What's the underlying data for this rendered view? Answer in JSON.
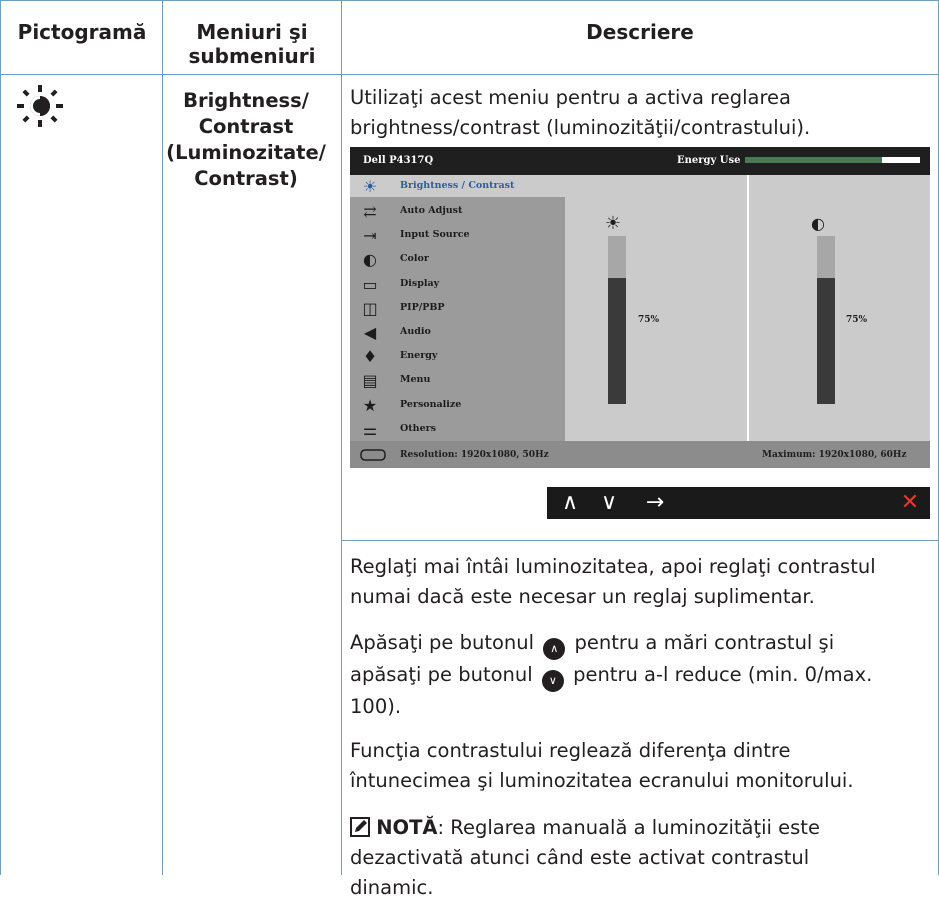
{
  "header": {
    "col1": "Pictogramă",
    "col2_line1": "Meniuri şi",
    "col2_line2": "submeniuri",
    "col3": "Descriere"
  },
  "menu_name": {
    "line1": "Brightness/",
    "line2": "Contrast",
    "line3": "(Luminozitate/",
    "line4": "Contrast)"
  },
  "intro": {
    "line1": "Utilizaţi acest meniu pentru a activa reglarea",
    "line2": "brightness/contrast (luminozităţii/contrastului)."
  },
  "osd": {
    "title": "Dell P4317Q",
    "energy_label": "Energy Use",
    "energy_level": 0.78,
    "items": [
      {
        "icon": "brightness-icon",
        "glyph": "☀",
        "label": "Brightness / Contrast",
        "selected": true
      },
      {
        "icon": "auto-adjust-icon",
        "glyph": "⇄",
        "label": "Auto Adjust"
      },
      {
        "icon": "input-source-icon",
        "glyph": "⇥",
        "label": "Input Source"
      },
      {
        "icon": "color-icon",
        "glyph": "◐",
        "label": "Color"
      },
      {
        "icon": "display-icon",
        "glyph": "▭",
        "label": "Display"
      },
      {
        "icon": "pip-pbp-icon",
        "glyph": "◫",
        "label": "PIP/PBP"
      },
      {
        "icon": "audio-icon",
        "glyph": "◀",
        "label": "Audio"
      },
      {
        "icon": "energy-icon",
        "glyph": "♦",
        "label": "Energy"
      },
      {
        "icon": "menu-icon",
        "glyph": "▤",
        "label": "Menu"
      },
      {
        "icon": "personalize-icon",
        "glyph": "★",
        "label": "Personalize"
      },
      {
        "icon": "others-icon",
        "glyph": "⚌",
        "label": "Others"
      }
    ],
    "brightness": {
      "icon": "☀",
      "value_label": "75%",
      "level": 0.75
    },
    "contrast": {
      "icon": "◐",
      "value_label": "75%",
      "level": 0.75
    },
    "resolution": "Resolution: 1920x1080, 50Hz",
    "maximum": "Maximum: 1920x1080, 60Hz",
    "buttons": {
      "up": "∧",
      "down": "∨",
      "enter": "→",
      "exit": "✕"
    }
  },
  "para1": {
    "line1": "Reglaţi mai întâi luminozitatea, apoi reglaţi contrastul",
    "line2": "numai dacă este necesar un reglaj suplimentar."
  },
  "para2": {
    "line1_a": "Apăsaţi pe butonul",
    "line1_b": "pentru a mări contrastul şi",
    "line2_a": "apăsaţi pe butonul",
    "line2_b": "pentru a-l reduce (min. 0/max.",
    "line3": "100)."
  },
  "para3": {
    "line1": "Funcţia contrastului reglează diferenţa dintre",
    "line2": "întunecimea şi luminozitatea ecranului monitorului."
  },
  "note": {
    "label": "NOTĂ",
    "line1": ": Reglarea manuală a luminozităţii este",
    "line2": "dezactivată atunci când este activat contrastul",
    "line3": "dinamic."
  },
  "colors": {
    "table_lines": "#6f9fbd",
    "energy_green": "#487a53",
    "osd_highlight": "#2a5ea0",
    "exit_red": "#e8372f"
  }
}
